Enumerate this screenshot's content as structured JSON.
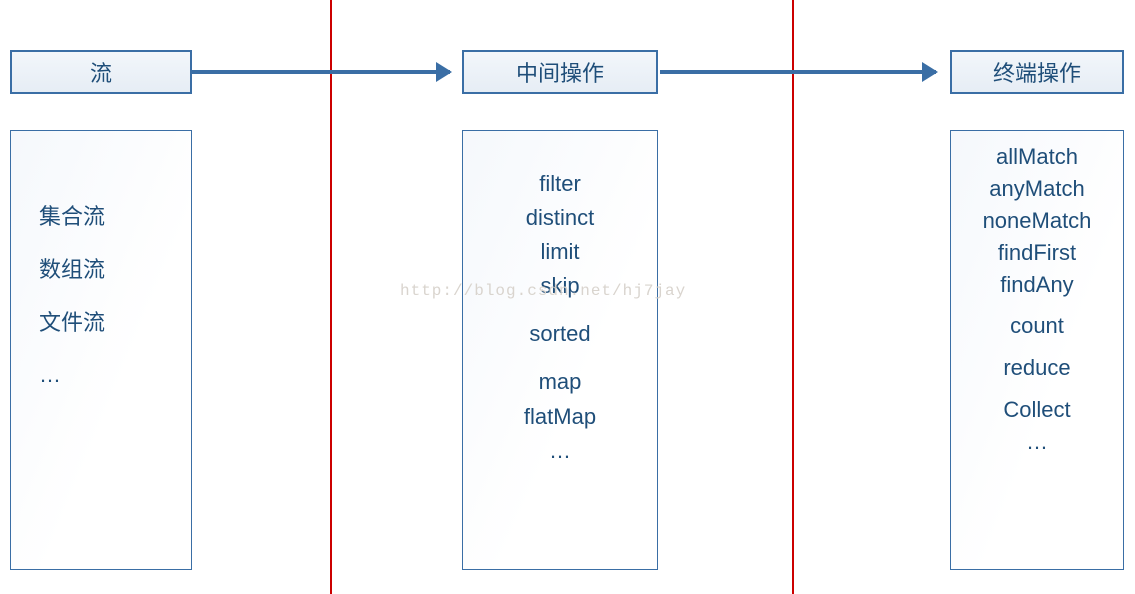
{
  "watermark": "http://blog.csdn.net/hj7jay",
  "stages": {
    "source": {
      "title": "流",
      "items": [
        "集合流",
        "数组流",
        "文件流",
        "…"
      ]
    },
    "intermediate": {
      "title": "中间操作",
      "groups": [
        [
          "filter",
          "distinct",
          "limit",
          "skip"
        ],
        [
          "sorted"
        ],
        [
          "map",
          "flatMap",
          "…"
        ]
      ]
    },
    "terminal": {
      "title": "终端操作",
      "groups": [
        [
          "allMatch",
          "anyMatch",
          "noneMatch",
          "findFirst",
          "findAny"
        ],
        [
          "count"
        ],
        [
          "reduce"
        ],
        [
          "Collect",
          "…"
        ]
      ]
    }
  }
}
